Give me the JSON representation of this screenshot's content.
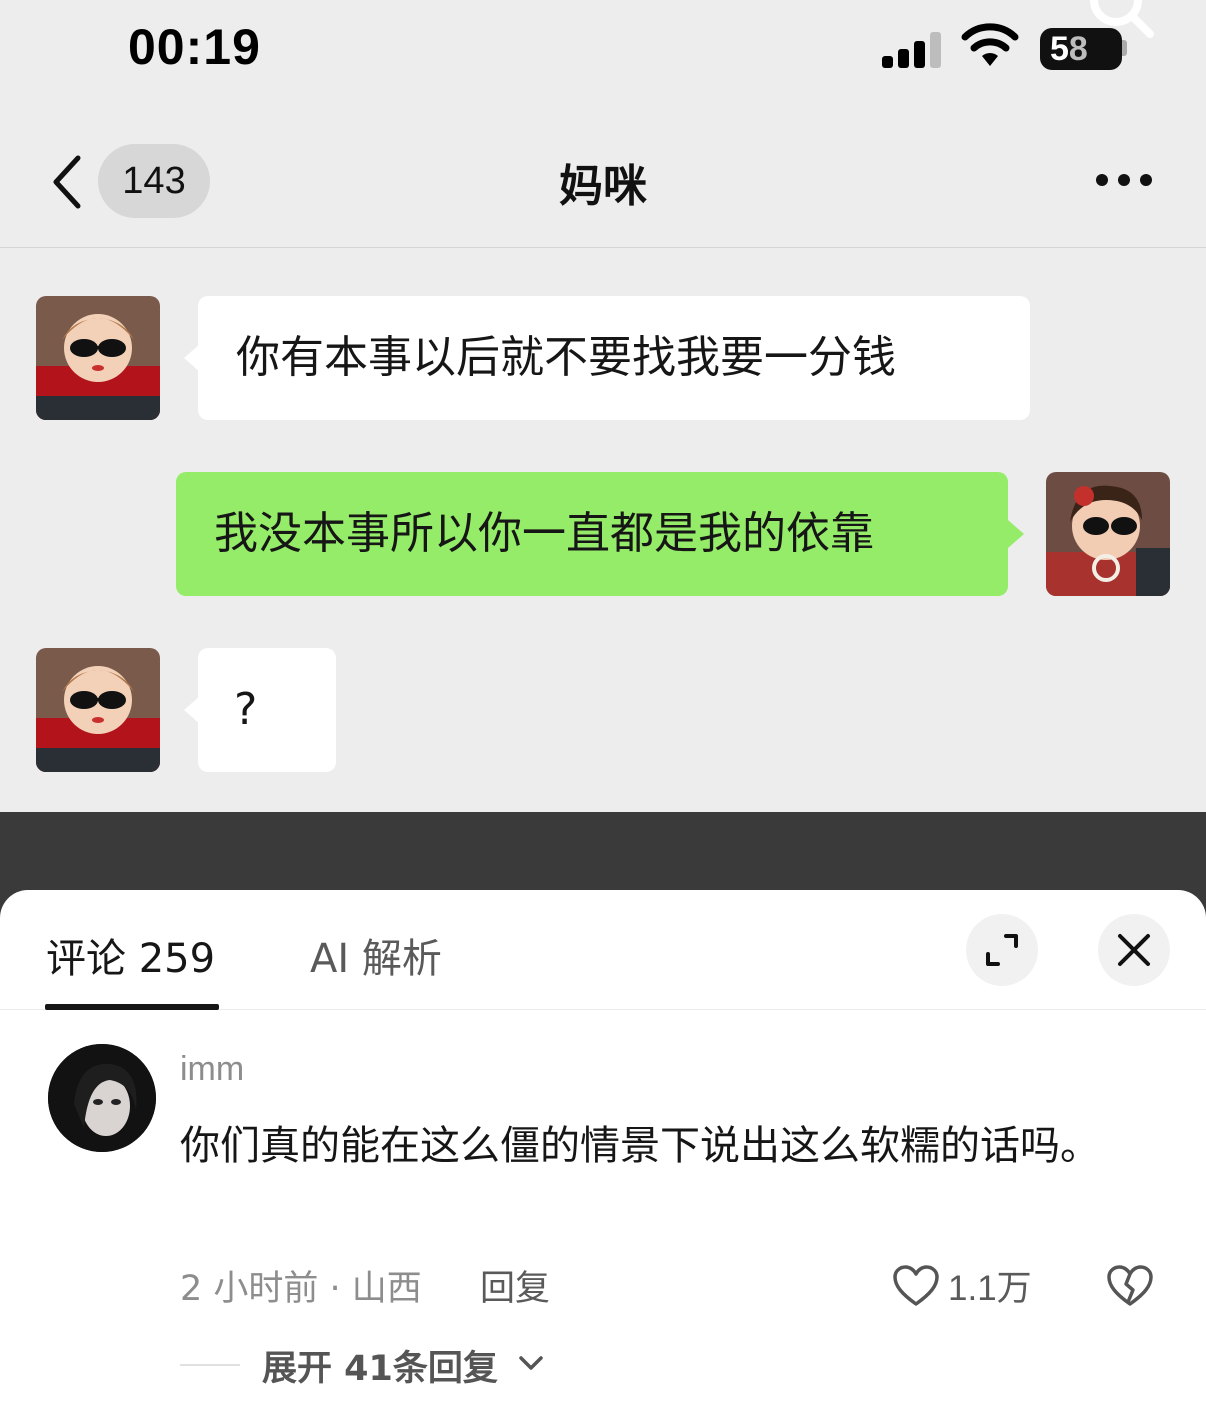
{
  "status_bar": {
    "time": "00:19",
    "battery_main": "5",
    "battery_rest": "8"
  },
  "chat_header": {
    "unread_count": "143",
    "title": "妈咪"
  },
  "messages": [
    {
      "side": "left",
      "text": "你有本事以后就不要找我要一分钱"
    },
    {
      "side": "right",
      "text": "我没本事所以你一直都是我的依靠"
    },
    {
      "side": "left",
      "text": "?"
    }
  ],
  "sheet": {
    "tab_comments": "评论 259",
    "tab_ai": "AI 解析"
  },
  "comment": {
    "username": "imm",
    "text": "你们真的能在这么僵的情景下说出这么软糯的话吗。",
    "meta": "2 小时前 · 山西",
    "reply_label": "回复",
    "likes": "1.1万",
    "expand_replies": "展开 41条回复"
  },
  "icons": [
    "search-icon",
    "signal-icon",
    "wifi-icon",
    "battery-icon",
    "back-icon",
    "more-icon",
    "expand-icon",
    "close-icon",
    "heart-icon",
    "broken-heart-icon",
    "chevron-down-icon"
  ],
  "colors": {
    "green_bubble": "#95ec69",
    "chat_bg": "#ededed",
    "dark_band": "#3a3a3b"
  }
}
